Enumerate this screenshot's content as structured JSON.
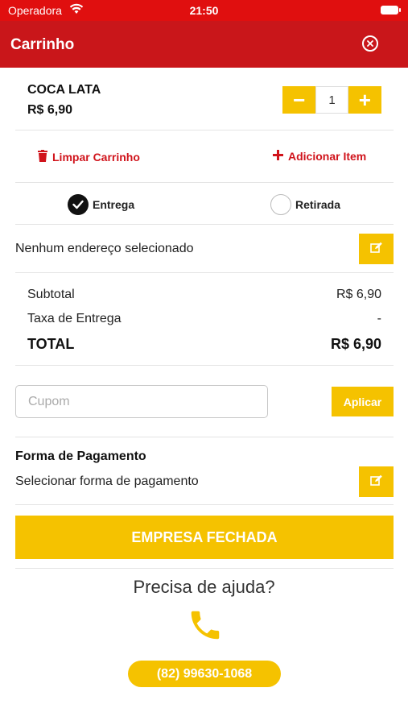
{
  "status_bar": {
    "carrier": "Operadora",
    "time": "21:50"
  },
  "header": {
    "title": "Carrinho"
  },
  "cart_item": {
    "name": "COCA LATA",
    "price": "R$ 6,90",
    "quantity": "1",
    "minus": "−",
    "plus": "+"
  },
  "actions": {
    "clear": "Limpar Carrinho",
    "add": "Adicionar Item"
  },
  "delivery": {
    "option_delivery": "Entrega",
    "option_pickup": "Retirada",
    "selected": "Entrega"
  },
  "address": {
    "text": "Nenhum endereço selecionado"
  },
  "summary": {
    "subtotal_label": "Subtotal",
    "subtotal_value": "R$ 6,90",
    "fee_label": "Taxa de Entrega",
    "fee_value": "-",
    "total_label": "TOTAL",
    "total_value": "R$ 6,90"
  },
  "coupon": {
    "placeholder": "Cupom",
    "apply_label": "Aplicar"
  },
  "payment": {
    "title": "Forma de Pagamento",
    "select_text": "Selecionar forma de pagamento"
  },
  "closed_button": {
    "label": "EMPRESA FECHADA"
  },
  "help": {
    "title": "Precisa de ajuda?",
    "phone": "(82) 99630-1068"
  },
  "colors": {
    "red": "#c9161a",
    "status_red": "#e00f0f",
    "yellow": "#f5c200",
    "action_red": "#d0131b"
  },
  "icons": [
    "wifi-icon",
    "battery-icon",
    "close-circle-icon",
    "trash-icon",
    "plus-icon",
    "check-icon",
    "edit-icon",
    "phone-icon"
  ]
}
